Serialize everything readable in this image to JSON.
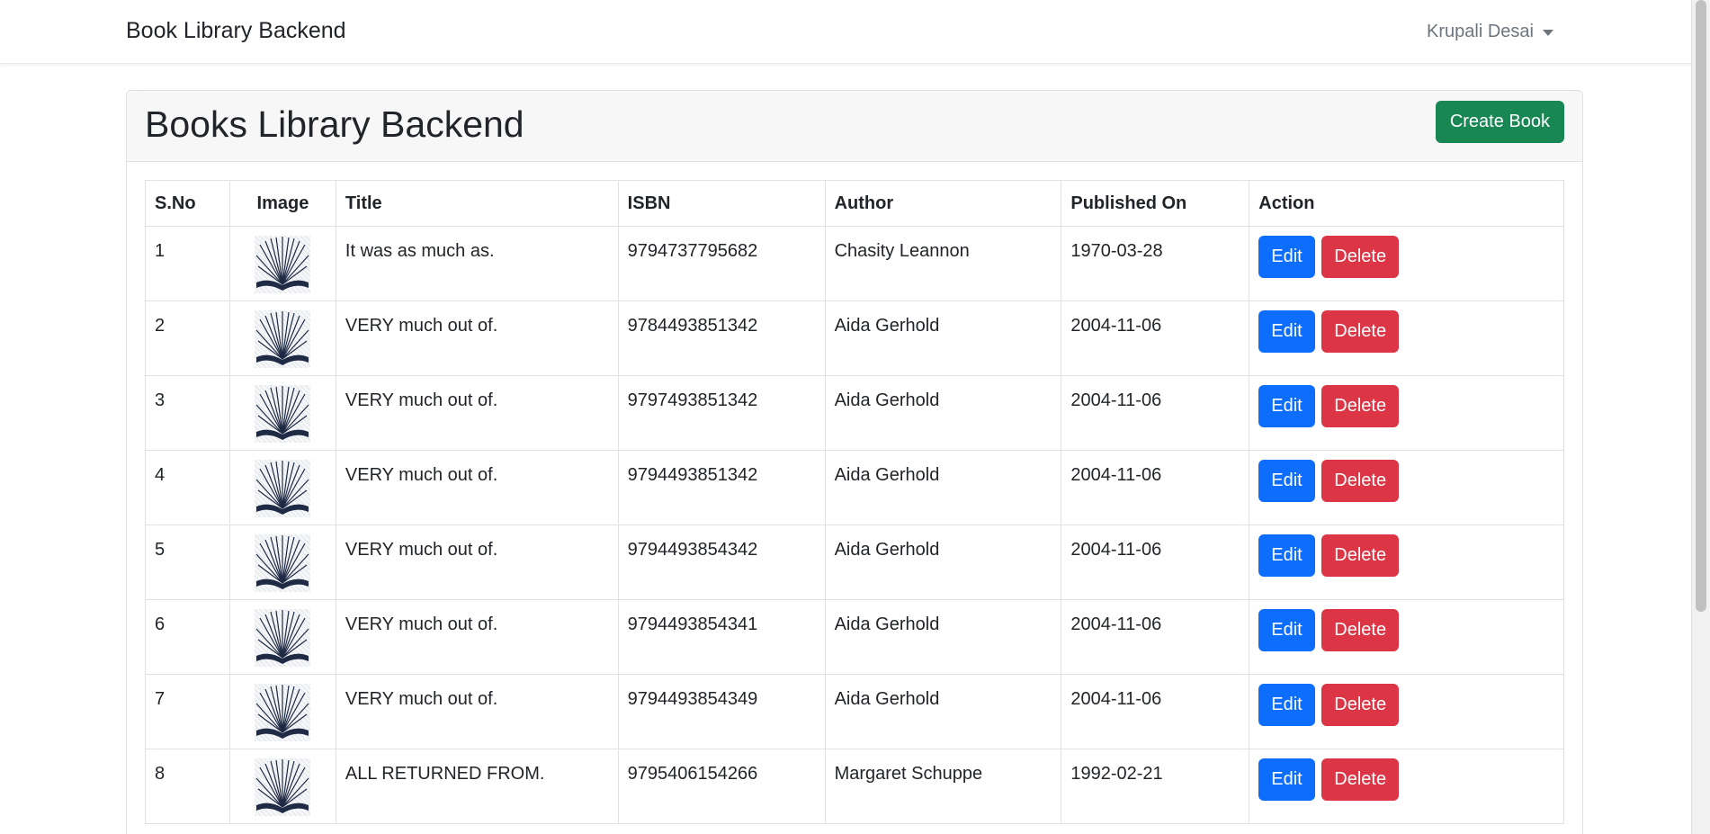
{
  "navbar": {
    "brand": "Book Library Backend",
    "user_name": "Krupali Desai"
  },
  "card": {
    "title": "Books Library Backend",
    "create_button": "Create Book"
  },
  "table": {
    "headers": {
      "sno": "S.No",
      "image": "Image",
      "title": "Title",
      "isbn": "ISBN",
      "author": "Author",
      "published": "Published On",
      "action": "Action"
    },
    "edit_label": "Edit",
    "delete_label": "Delete",
    "rows": [
      {
        "sno": "1",
        "title": "It was as much as.",
        "isbn": "9794737795682",
        "author": "Chasity Leannon",
        "published": "1970-03-28"
      },
      {
        "sno": "2",
        "title": "VERY much out of.",
        "isbn": "9784493851342",
        "author": "Aida Gerhold",
        "published": "2004-11-06"
      },
      {
        "sno": "3",
        "title": "VERY much out of.",
        "isbn": "9797493851342",
        "author": "Aida Gerhold",
        "published": "2004-11-06"
      },
      {
        "sno": "4",
        "title": "VERY much out of.",
        "isbn": "9794493851342",
        "author": "Aida Gerhold",
        "published": "2004-11-06"
      },
      {
        "sno": "5",
        "title": "VERY much out of.",
        "isbn": "9794493854342",
        "author": "Aida Gerhold",
        "published": "2004-11-06"
      },
      {
        "sno": "6",
        "title": "VERY much out of.",
        "isbn": "9794493854341",
        "author": "Aida Gerhold",
        "published": "2004-11-06"
      },
      {
        "sno": "7",
        "title": "VERY much out of.",
        "isbn": "9794493854349",
        "author": "Aida Gerhold",
        "published": "2004-11-06"
      },
      {
        "sno": "8",
        "title": "ALL RETURNED FROM.",
        "isbn": "9795406154266",
        "author": "Margaret Schuppe",
        "published": "1992-02-21"
      }
    ]
  },
  "colors": {
    "create": "#198754",
    "edit": "#0d6efd",
    "delete": "#dc3545"
  },
  "icons": {
    "book": "open-book-icon",
    "caret": "caret-down-icon"
  }
}
